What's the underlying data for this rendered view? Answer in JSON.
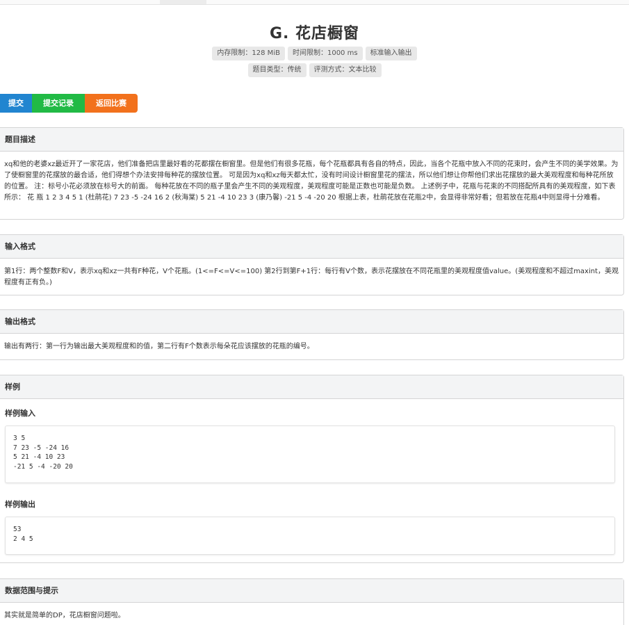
{
  "problem": {
    "title": "G. 花店橱窗",
    "badges_row1": [
      "内存限制：128 MiB",
      "时间限制：1000 ms",
      "标准输入输出"
    ],
    "badges_row2": [
      "题目类型：传统",
      "评测方式：文本比较"
    ]
  },
  "actions": {
    "submit": "提交",
    "records": "提交记录",
    "back": "返回比赛"
  },
  "sections": {
    "description": {
      "heading": "题目描述",
      "text": "xq和他的老婆xz最近开了一家花店，他们准备把店里最好看的花都摆在橱窗里。但是他们有很多花瓶，每个花瓶都具有各自的特点，因此，当各个花瓶中放入不同的花束时，会产生不同的美学效果。为了使橱窗里的花摆放的最合适，他们得想个办法安排每种花的摆放位置。 可是因为xq和xz每天都太忙，没有时间设计橱窗里花的摆法，所以他们想让你帮他们求出花摆放的最大美观程度和每种花所放的位置。 注：标号小花必须放在标号大的前面。 每种花放在不同的瓶子里会产生不同的美观程度，美观程度可能是正数也可能是负数。 上述例子中，花瓶与花束的不同搭配所具有的美观程度，如下表所示： 花 瓶 1 2 3 4 5 1 (杜鹃花) 7 23 -5 -24 16 2 (秋海棠) 5 21 -4 10 23 3 (康乃馨) -21 5 -4 -20 20 根据上表，杜鹃花放在花瓶2中，会显得非常好看；但若放在花瓶4中则显得十分难看。"
    },
    "input": {
      "heading": "输入格式",
      "text": "第1行：两个整数F和V，表示xq和xz一共有F种花，V个花瓶。(1<=F<=V<=100) 第2行到第F+1行：每行有V个数，表示花摆放在不同花瓶里的美观程度值value。(美观程度和不超过maxint，美观程度有正有负。)"
    },
    "output": {
      "heading": "输出格式",
      "text": "输出有两行：第一行为输出最大美观程度和的值，第二行有F个数表示每朵花应该摆放的花瓶的编号。"
    },
    "sample": {
      "heading": "样例",
      "input_heading": "样例输入",
      "input_lines": [
        "3 5",
        "7 23 -5 -24 16",
        "5 21 -4 10 23",
        "-21 5 -4 -20 20"
      ],
      "output_heading": "样例输出",
      "output_lines": [
        "53",
        "2 4 5"
      ]
    },
    "hint": {
      "heading": "数据范围与提示",
      "text": "其实就是简单的DP，花店橱窗问题啦。"
    }
  }
}
